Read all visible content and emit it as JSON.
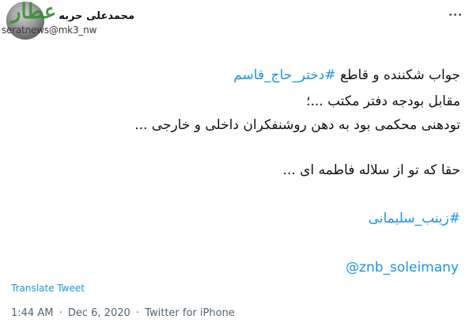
{
  "author": {
    "display_name": "محمدعلی حربه",
    "handle": "@mk3_nw",
    "watermark_logo": "عطار",
    "watermark_site": "seratnews"
  },
  "tweet": {
    "line1_hashtag": "#دختر_حاج_قاسم",
    "line1_text": "جواب شکننده و قاطع",
    "line2": "مقابل بودجه دفتر مکتب ...؛",
    "line3": "تودهنی محکمی بود به دهن روشنفکران داخلی و خارجی ...",
    "line4": "حقا که تو از سلاله فاطمه ای ...",
    "hashtag2": "#زینب_سلیمانی",
    "mention": "@znb_soleimany"
  },
  "translate_label": "Translate Tweet",
  "meta": {
    "time": "1:44 AM",
    "date": "Dec 6, 2020",
    "source": "Twitter for iPhone",
    "separator": "·"
  },
  "colors": {
    "link": "#1b95e0",
    "text": "#0f1419",
    "muted": "#536471"
  }
}
